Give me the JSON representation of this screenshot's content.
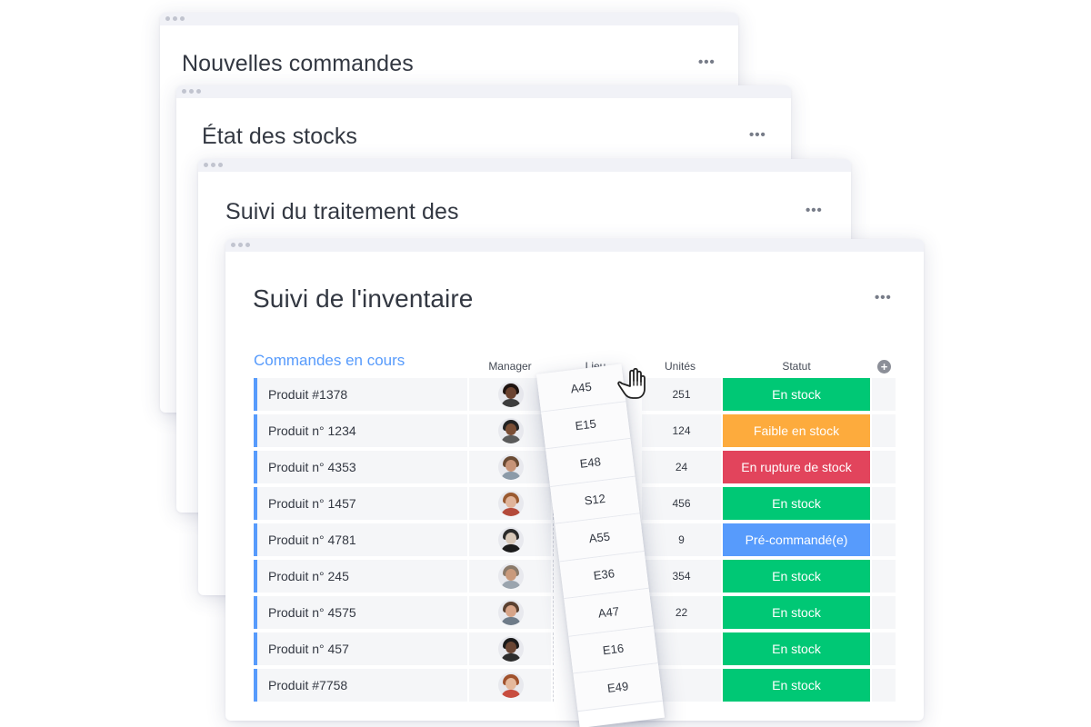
{
  "windows": [
    {
      "title": "Nouvelles commandes",
      "menu": "•••"
    },
    {
      "title": "État des stocks",
      "menu": "•••"
    },
    {
      "title": "Suivi du traitement des",
      "menu": "•••"
    },
    {
      "title": "Suivi de l'inventaire",
      "menu": "•••"
    }
  ],
  "board": {
    "group_title": "Commandes en cours",
    "columns": {
      "manager": "Manager",
      "location": "Lieu",
      "units": "Unités",
      "status": "Statut"
    },
    "add_column": "+",
    "rows": [
      {
        "name": "Produit #1378",
        "units": "251",
        "status": "En stock",
        "status_color": "#00c875",
        "avatar": "avatar-1"
      },
      {
        "name": "Produit n° 1234",
        "units": "124",
        "status": "Faible en stock",
        "status_color": "#fdab3d",
        "avatar": "avatar-2"
      },
      {
        "name": "Produit n° 4353",
        "units": "24",
        "status": "En rupture de stock",
        "status_color": "#e2445c",
        "avatar": "avatar-3"
      },
      {
        "name": "Produit n° 1457",
        "units": "456",
        "status": "En stock",
        "status_color": "#00c875",
        "avatar": "avatar-4"
      },
      {
        "name": "Produit n° 4781",
        "units": "9",
        "status": "Pré-commandé(e)",
        "status_color": "#579bfc",
        "avatar": "avatar-5"
      },
      {
        "name": "Produit n° 245",
        "units": "354",
        "status": "En stock",
        "status_color": "#00c875",
        "avatar": "avatar-6"
      },
      {
        "name": "Produit n° 4575",
        "units": "22",
        "status": "En stock",
        "status_color": "#00c875",
        "avatar": "avatar-7"
      },
      {
        "name": "Produit n° 457",
        "units": "",
        "status": "En stock",
        "status_color": "#00c875",
        "avatar": "avatar-8"
      },
      {
        "name": "Produit #7758",
        "units": "",
        "status": "En stock",
        "status_color": "#00c875",
        "avatar": "avatar-9"
      }
    ]
  },
  "dragged_column": {
    "values": [
      "A45",
      "E15",
      "E48",
      "S12",
      "A55",
      "E36",
      "A47",
      "E16",
      "E49"
    ]
  },
  "icons": {
    "cursor": "grab-hand-icon",
    "add": "plus-circle-icon",
    "menu": "more-dots-icon"
  },
  "colors": {
    "accent": "#579bfc",
    "done": "#00c875",
    "working": "#fdab3d",
    "stuck": "#e2445c"
  }
}
